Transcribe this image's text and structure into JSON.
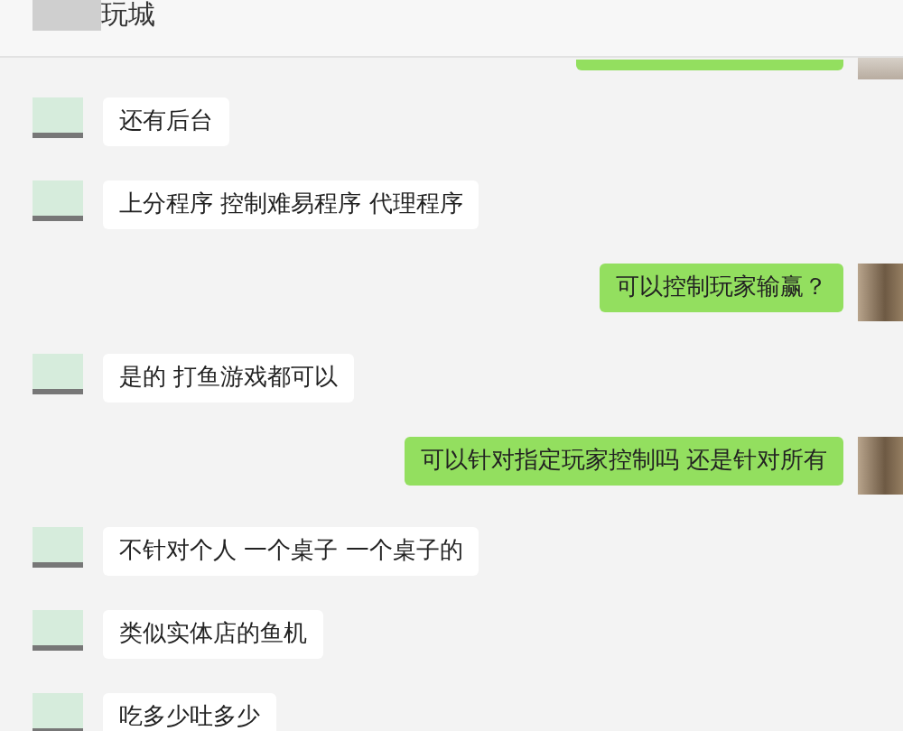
{
  "header": {
    "title": "玩城"
  },
  "messages": [
    {
      "kind": "outgoing"
    },
    {
      "kind": "incoming",
      "text": "还有后台"
    },
    {
      "kind": "incoming",
      "text": "上分程序 控制难易程序 代理程序"
    },
    {
      "kind": "outgoing",
      "text": "可以控制玩家输赢？"
    },
    {
      "kind": "incoming",
      "text": "是的 打鱼游戏都可以"
    },
    {
      "kind": "outgoing",
      "text": "可以针对指定玩家控制吗  还是针对所有"
    },
    {
      "kind": "incoming",
      "text": "不针对个人 一个桌子 一个桌子的"
    },
    {
      "kind": "incoming",
      "text": "类似实体店的鱼机"
    },
    {
      "kind": "incoming",
      "text": "吃多少吐多少"
    }
  ]
}
